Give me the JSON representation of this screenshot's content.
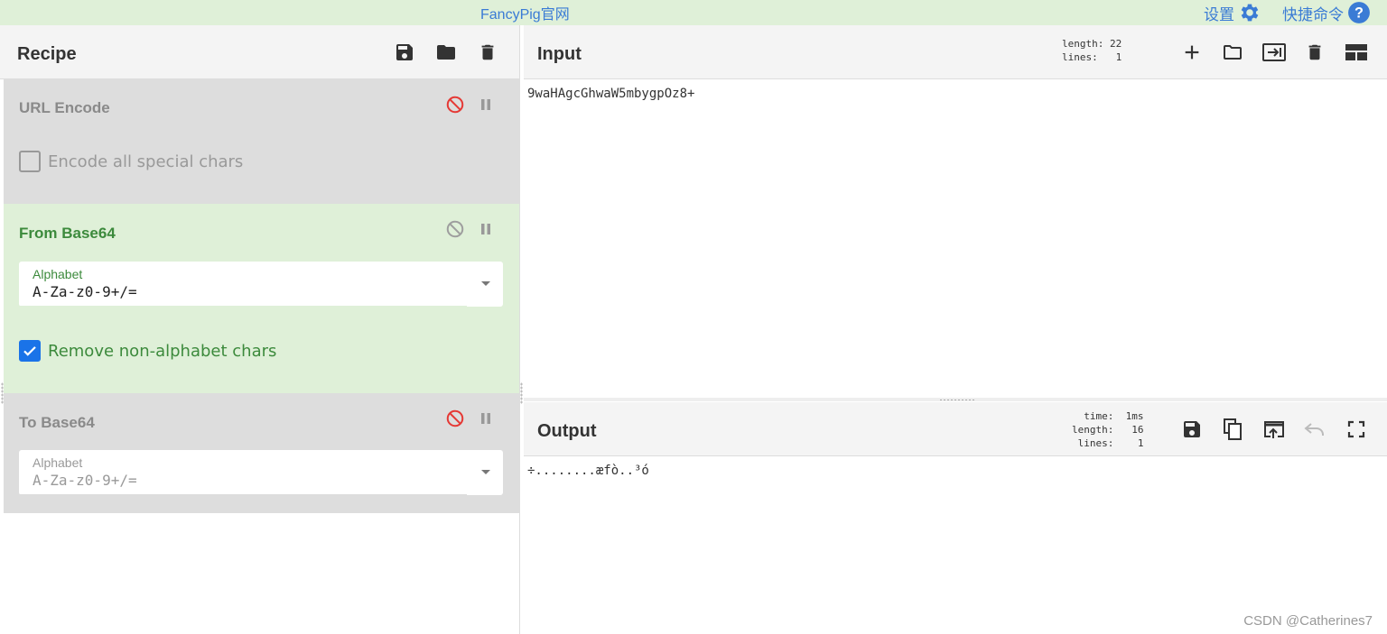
{
  "topbar": {
    "site_link": "FancyPig官网",
    "settings_label": "设置",
    "settings_icon": "gear-icon",
    "shortcuts_label": "快捷命令",
    "shortcuts_icon": "question-circle-icon",
    "accent_color": "#3a7bd5",
    "background": "#dff0d8"
  },
  "recipe": {
    "title": "Recipe",
    "actions": [
      "save-icon",
      "folder-icon",
      "trash-icon"
    ],
    "operations": [
      {
        "name": "URL Encode",
        "state": "disabled",
        "options": [
          {
            "type": "checkbox",
            "label": "Encode all special chars",
            "checked": false
          }
        ]
      },
      {
        "name": "From Base64",
        "state": "active",
        "options": [
          {
            "type": "select",
            "label": "Alphabet",
            "value": "A-Za-z0-9+/="
          },
          {
            "type": "checkbox",
            "label": "Remove non-alphabet chars",
            "checked": true
          }
        ]
      },
      {
        "name": "To Base64",
        "state": "disabled",
        "options": [
          {
            "type": "select",
            "label": "Alphabet",
            "value": "A-Za-z0-9+/="
          }
        ]
      }
    ]
  },
  "input": {
    "title": "Input",
    "stats": {
      "length_label": "length:",
      "length": "22",
      "lines_label": "lines:",
      "lines": "1"
    },
    "actions": [
      "plus-icon",
      "folder-icon",
      "import-icon",
      "trash-icon",
      "layout-icon"
    ],
    "text": "9waHAgcGhwaW5mbygpOz8+"
  },
  "output": {
    "title": "Output",
    "stats": {
      "time_label": "time:",
      "time": "1ms",
      "length_label": "length:",
      "length": "16",
      "lines_label": "lines:",
      "lines": "1"
    },
    "actions": [
      "save-icon",
      "copy-icon",
      "replace-input-icon",
      "undo-icon",
      "maximize-icon"
    ],
    "text": "÷........æfò..³ó"
  },
  "watermark": "CSDN @Catherines7"
}
